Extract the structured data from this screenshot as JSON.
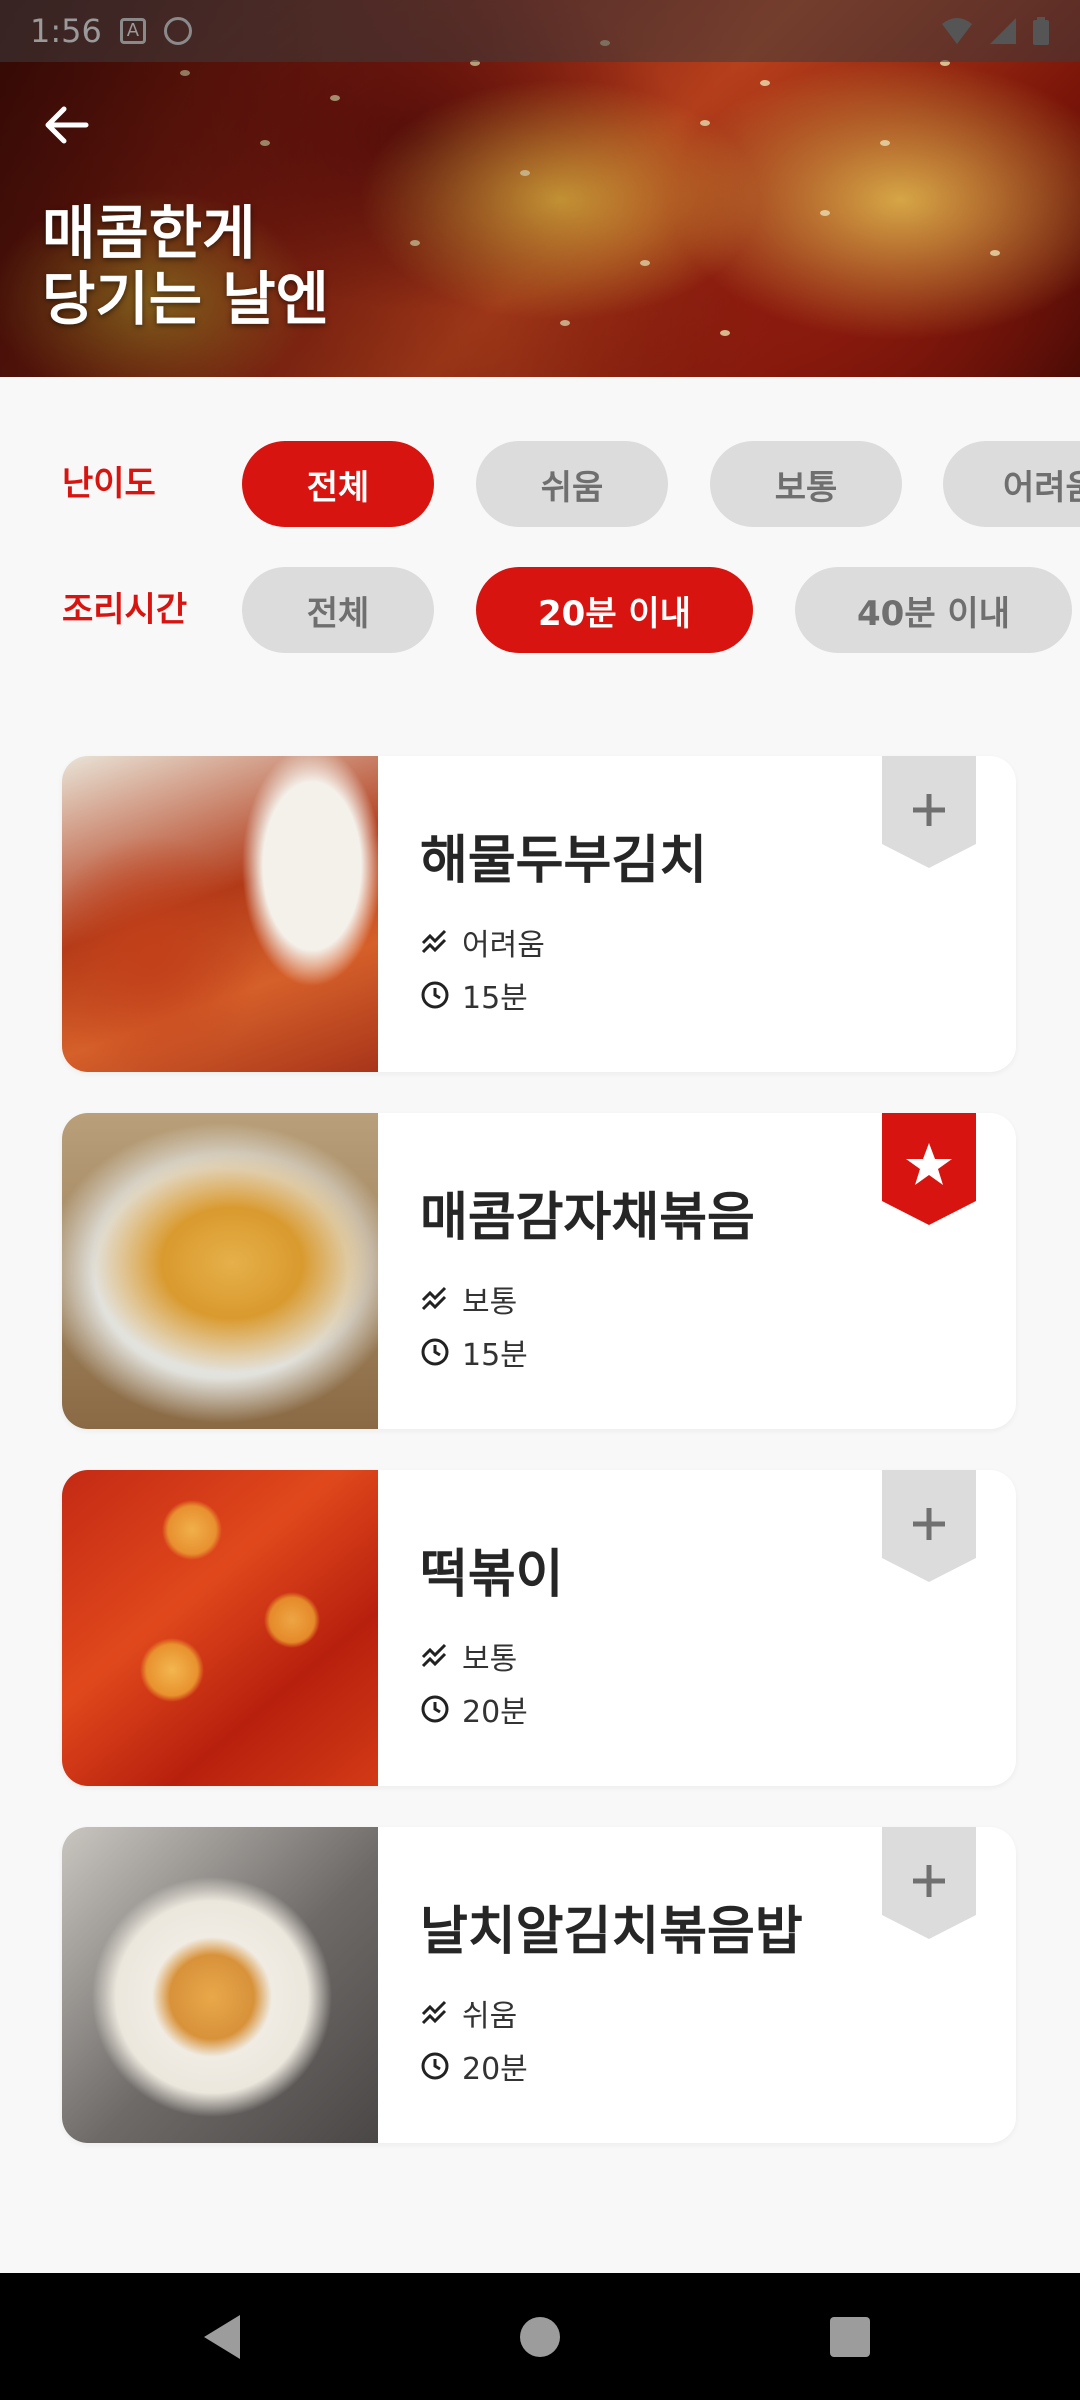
{
  "status_bar": {
    "time": "1:56",
    "a_badge": "A"
  },
  "hero": {
    "title_line1": "매콤한게",
    "title_line2": "당기는 날엔"
  },
  "filters": {
    "difficulty": {
      "label": "난이도",
      "options": [
        "전체",
        "쉬움",
        "보통",
        "어려움"
      ],
      "selected": "전체"
    },
    "cook_time": {
      "label": "조리시간",
      "options": [
        "전체",
        "20분 이내",
        "40분 이내"
      ],
      "selected": "20분 이내"
    }
  },
  "recipes": [
    {
      "name": "해물두부김치",
      "difficulty": "어려움",
      "time": "15분",
      "bookmarked": false
    },
    {
      "name": "매콤감자채볶음",
      "difficulty": "보통",
      "time": "15분",
      "bookmarked": true
    },
    {
      "name": "떡볶이",
      "difficulty": "보통",
      "time": "20분",
      "bookmarked": false
    },
    {
      "name": "날치알김치볶음밥",
      "difficulty": "쉬움",
      "time": "20분",
      "bookmarked": false
    }
  ],
  "icons": {
    "back": "arrow-left-icon",
    "difficulty": "trend-icon",
    "time": "clock-icon",
    "bookmark_off": "plus-icon",
    "bookmark_on": "star-icon"
  },
  "colors": {
    "accent": "#d7140f",
    "chip_inactive": "#dcdcdc",
    "bookmark_inactive": "#dcdcdc"
  }
}
